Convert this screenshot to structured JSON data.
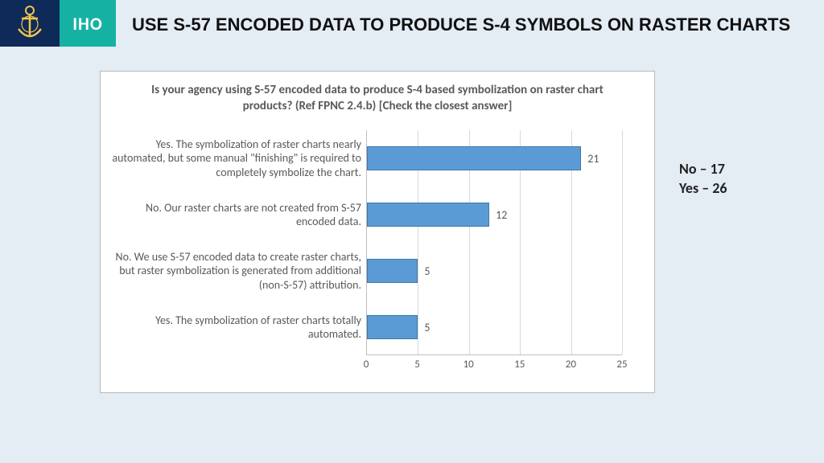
{
  "header": {
    "iho_label": "IHO",
    "title": "USE S-57 ENCODED DATA TO PRODUCE S-4 SYMBOLS ON RASTER CHARTS"
  },
  "chart_data": {
    "type": "bar",
    "orientation": "horizontal",
    "title": "Is your agency using S-57 encoded data to produce S-4 based symbolization on raster chart products? (Ref FPNC 2.4.b) [Check the closest answer]",
    "categories": [
      "Yes. The symbolization of raster charts nearly automated, but some manual \"finishing\" is required to completely symbolize the chart.",
      "No. Our raster charts are not created from S-57 encoded data.",
      "No. We use S-57 encoded data to create raster charts, but raster symbolization is generated from additional (non-S-57) attribution.",
      "Yes. The symbolization of raster charts totally automated."
    ],
    "values": [
      21,
      12,
      5,
      5
    ],
    "xlabel": "",
    "ylabel": "",
    "xlim": [
      0,
      25
    ],
    "x_ticks": [
      0,
      5,
      10,
      15,
      20,
      25
    ]
  },
  "summary": {
    "no_label": "No – 17",
    "yes_label": "Yes – 26"
  }
}
